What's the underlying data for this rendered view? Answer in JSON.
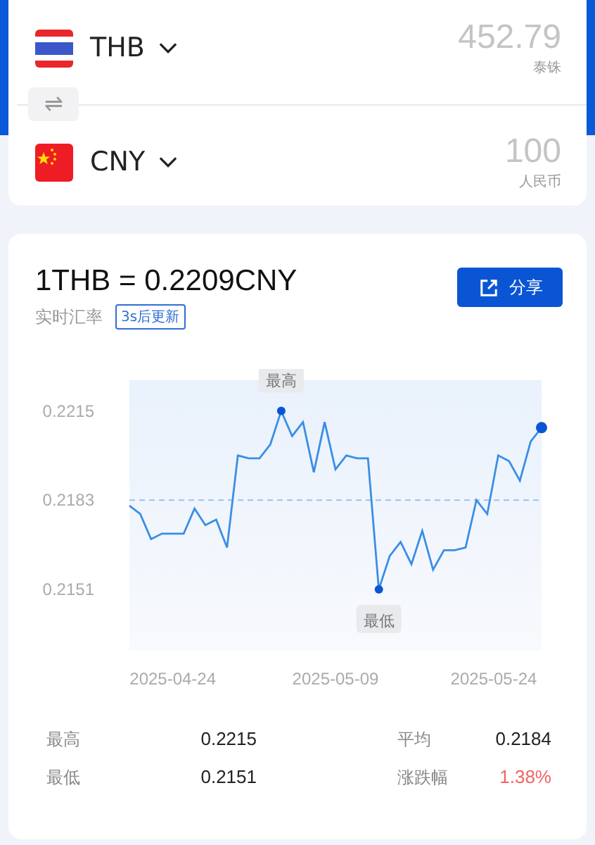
{
  "converter": [
    {
      "code": "THB",
      "amount": "452.79",
      "name": "泰铢"
    },
    {
      "code": "CNY",
      "amount": "100",
      "name": "人民币"
    }
  ],
  "swap_button": "⇌",
  "rate": {
    "title": "1THB = 0.2209CNY",
    "subtitle": "实时汇率",
    "badge": "3s后更新",
    "share_button": "分享"
  },
  "chart_data": {
    "type": "line",
    "categories": [
      null,
      null,
      null,
      null,
      "2025-04-24",
      null,
      null,
      null,
      null,
      null,
      null,
      null,
      null,
      null,
      null,
      null,
      null,
      null,
      null,
      "2025-05-09",
      null,
      null,
      null,
      null,
      null,
      null,
      null,
      null,
      null,
      null,
      null,
      null,
      null,
      null,
      "2025-05-24",
      null,
      null,
      null,
      null
    ],
    "series": [
      {
        "color": "#3a8ee6",
        "values": [
          0.2181,
          0.2178,
          0.2169,
          0.2171,
          0.2171,
          0.2171,
          0.218,
          0.2174,
          0.2176,
          0.2166,
          0.2199,
          0.2198,
          0.2198,
          0.2203,
          0.2215,
          0.2206,
          0.2211,
          0.2193,
          0.2211,
          0.2194,
          0.2199,
          0.2198,
          0.2198,
          0.2151,
          0.2163,
          0.2168,
          0.216,
          0.2172,
          0.2158,
          0.2165,
          0.2165,
          0.2166,
          0.2183,
          0.2178,
          0.2199,
          0.2197,
          0.219,
          0.2204,
          0.2209
        ]
      }
    ],
    "ylim": [
      0.2129,
      0.2226
    ],
    "yticks": [
      0.2215,
      0.2183,
      0.2151
    ],
    "annotations": [
      {
        "text": "最高",
        "y": 0.2215
      },
      {
        "text": "最低",
        "y": 0.2151
      }
    ],
    "ref_lines": [
      {
        "axis": "y",
        "value": 0.2183
      }
    ]
  },
  "stats": [
    {
      "label": "最高",
      "value": "0.2215",
      "kind": "plain"
    },
    {
      "label": "平均",
      "value": "0.2184",
      "kind": "plain"
    },
    {
      "label": "最低",
      "value": "0.2151",
      "kind": "plain"
    },
    {
      "label": "涨跌幅",
      "value": "1.38%",
      "kind": "up"
    }
  ]
}
